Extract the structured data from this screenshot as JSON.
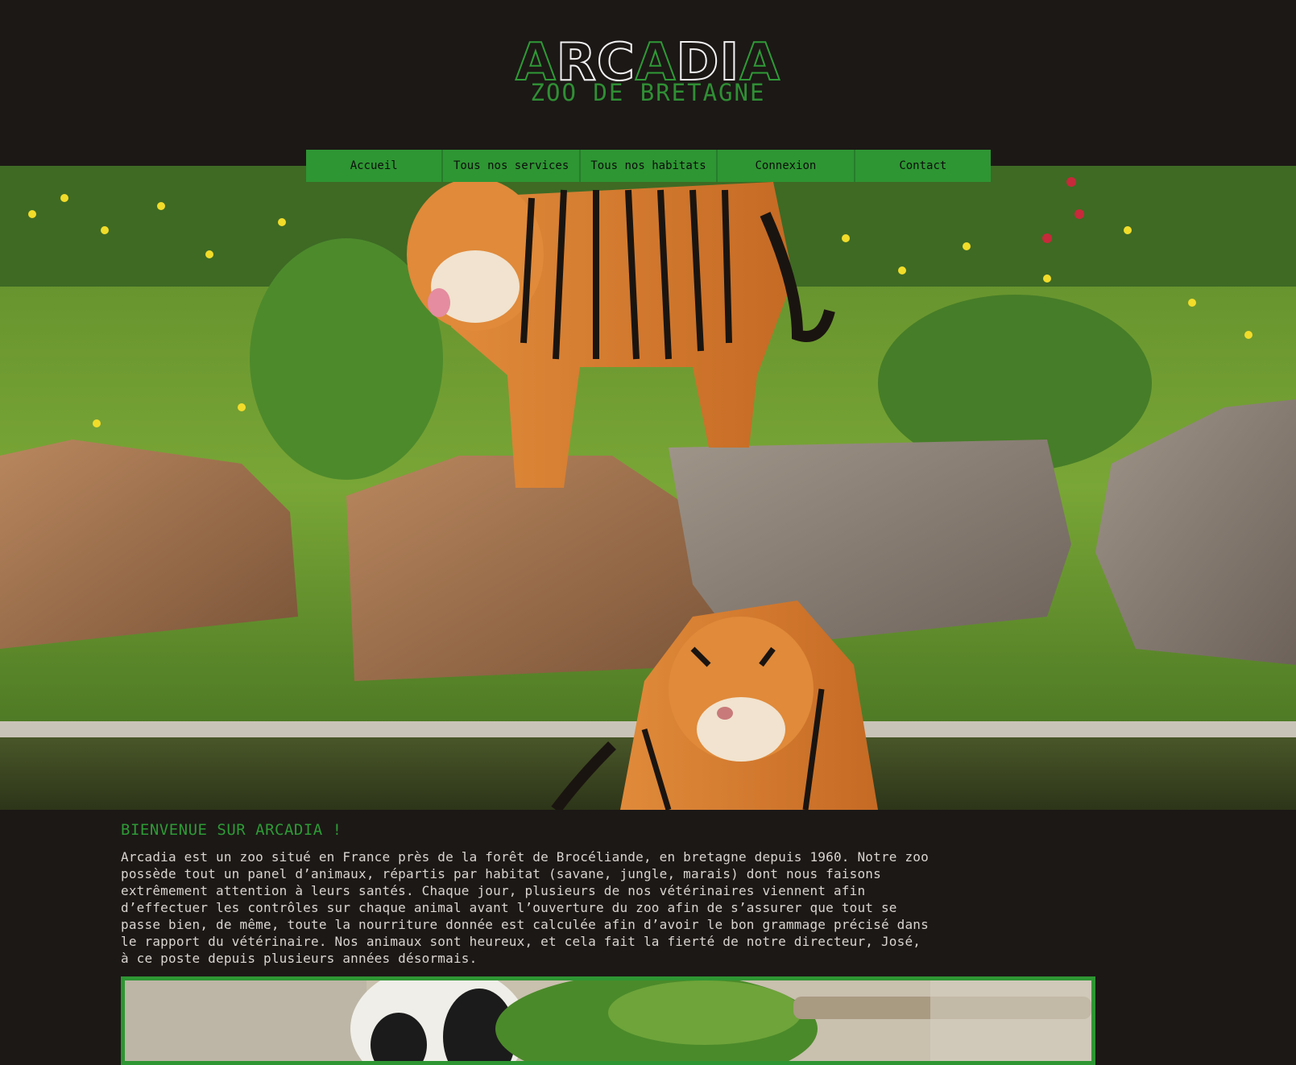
{
  "header": {
    "logo_title": "ARCADIA",
    "logo_subtitle": "ZOO DE BRETAGNE"
  },
  "nav": {
    "items": [
      {
        "label": "Accueil"
      },
      {
        "label": "Tous nos services"
      },
      {
        "label": "Tous nos habitats"
      },
      {
        "label": "Connexion"
      },
      {
        "label": "Contact"
      }
    ]
  },
  "hero": {
    "image": "tigers-on-rocks-by-water"
  },
  "main": {
    "heading": "BIENVENUE SUR ARCADIA !",
    "intro": "Arcadia est un zoo situé en France près de la forêt de Brocéliande, en bretagne depuis 1960. Notre zoo possède tout un panel d’animaux, répartis par habitat (savane, jungle, marais) dont nous faisons extrêmement attention à leurs santés. Chaque jour, plusieurs de nos vétérinaires viennent afin d’effectuer les contrôles sur chaque animal avant l’ouverture du zoo afin de s’assurer que tout se passe bien, de même, toute la nourriture donnée est calculée afin d’avoir le bon grammage précisé dans le rapport du vétérinaire. Nos animaux sont heureux, et cela fait la fierté de notre directeur, José, à ce poste depuis plusieurs années désormais.",
    "featured_image": "panda-in-bamboo"
  },
  "colors": {
    "background": "#1c1816",
    "accent_green": "#2e9633",
    "text": "#d9d4cf"
  }
}
